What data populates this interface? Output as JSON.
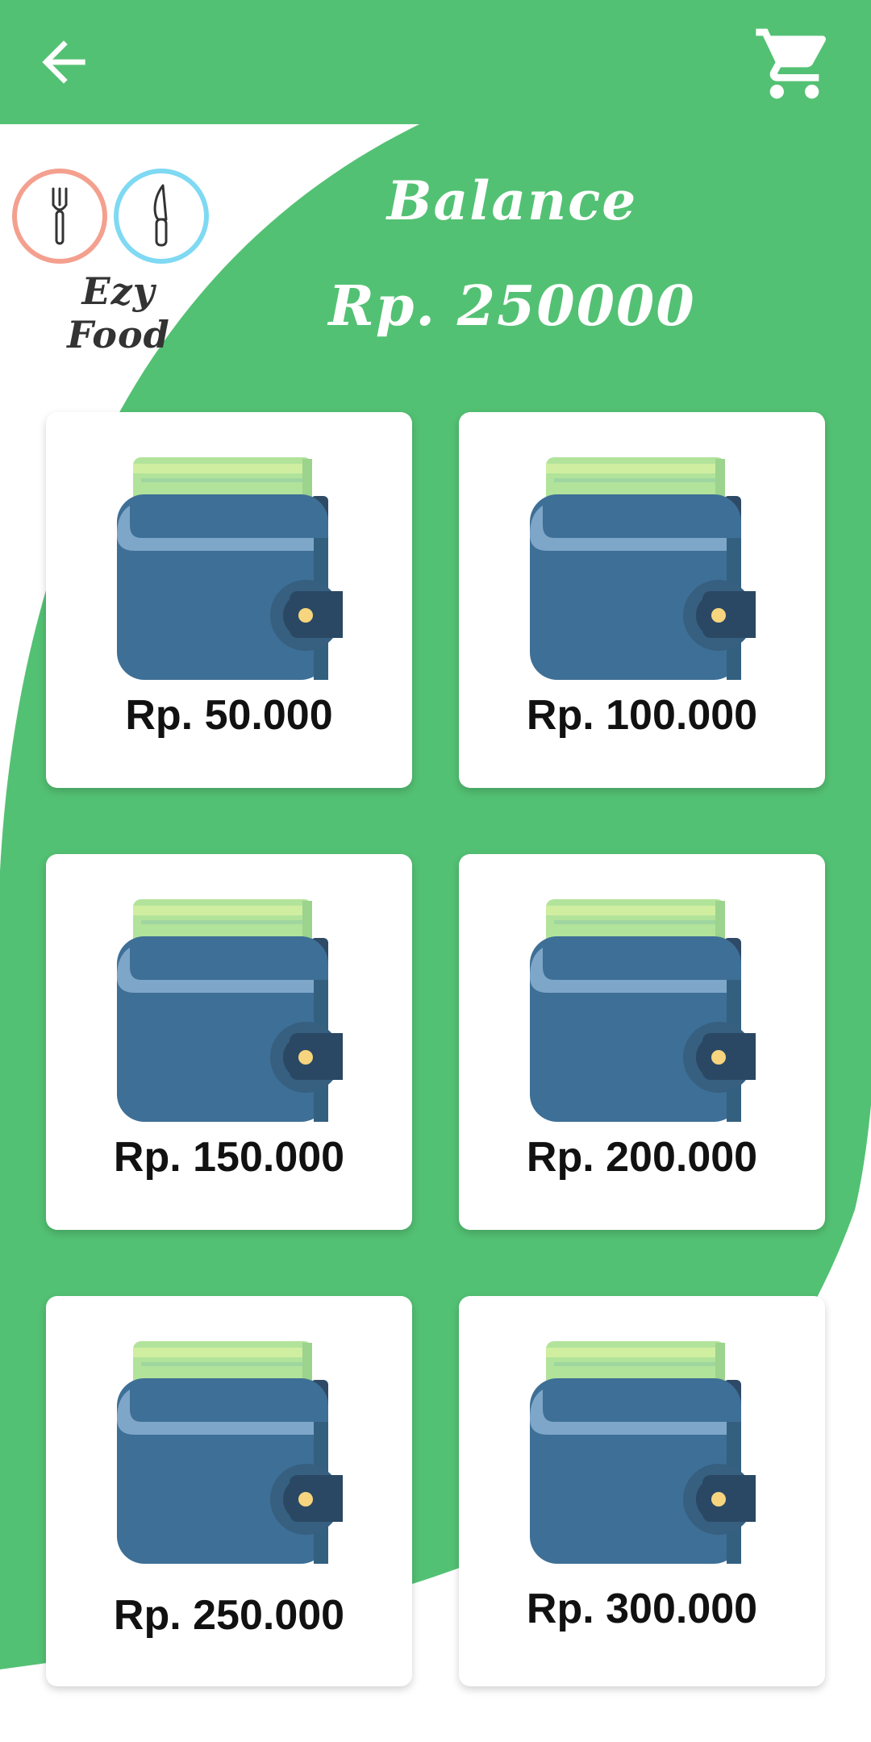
{
  "header": {
    "back_icon": "arrow-left-icon",
    "cart_icon": "shopping-cart-icon",
    "background_color": "#53c173"
  },
  "logo": {
    "text": "Ezy Food",
    "icons": [
      "fork-icon",
      "knife-icon"
    ],
    "ring_colors": [
      "#f4a08f",
      "#7fd9f3"
    ]
  },
  "balance": {
    "title": "Balance",
    "amount": "Rp. 250000"
  },
  "topup_options": [
    {
      "label": "Rp. 50.000",
      "icon": "wallet-icon"
    },
    {
      "label": "Rp. 100.000",
      "icon": "wallet-icon"
    },
    {
      "label": "Rp. 150.000",
      "icon": "wallet-icon"
    },
    {
      "label": "Rp. 200.000",
      "icon": "wallet-icon"
    },
    {
      "label": "Rp. 250.000",
      "icon": "wallet-icon"
    },
    {
      "label": "Rp. 300.000",
      "icon": "wallet-icon"
    }
  ],
  "colors": {
    "accent": "#53c173",
    "card": "#ffffff",
    "wallet_body": "#3e6f96",
    "wallet_cash": "#b2e39b"
  }
}
